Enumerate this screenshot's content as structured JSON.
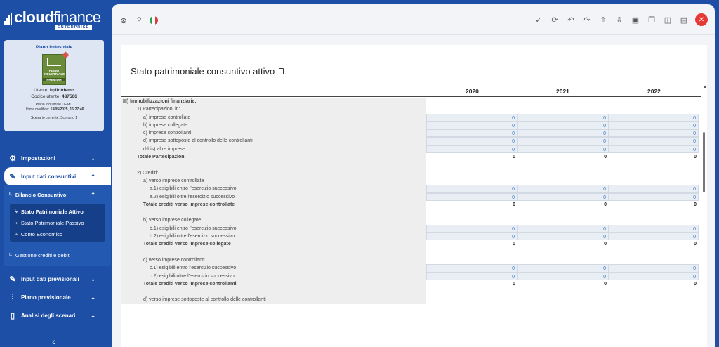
{
  "app": {
    "logo_bold": "cloud",
    "logo_light": "finance",
    "logo_sub": "ENTERPRISE"
  },
  "info": {
    "title": "Piano Industriale",
    "badge_lines": [
      "PIANO",
      "INDUSTRIALE"
    ],
    "badge_premium": "PREMIUM",
    "user_label": "Utente: ",
    "user": "bpilotdemo",
    "code_label": "Codice utente: ",
    "code": "487566",
    "plan": "Piano Industrale DEMO",
    "modified_label": "Ultima modifica: ",
    "modified": "13/05/2025, 16:27:46",
    "scenario": "Scenario corrente: Scenario 1"
  },
  "nav": {
    "impostazioni": "Impostazioni",
    "input_consuntivi": "Input dati consuntivi",
    "bilancio": "Bilancio Consuntivo",
    "sp_attivo": "Stato Patrimoniale Attivo",
    "sp_passivo": "Stato Patrimoniale Passivo",
    "conto_economico": "Conto Economico",
    "gestione_crediti": "Gestione crediti e debiti",
    "input_previsionali": "Input dati previsionali",
    "piano_previsionale": "Piano previsionale",
    "analisi_scenari": "Analisi degli scenari"
  },
  "page": {
    "title": "Stato patrimoniale consuntivo attivo",
    "years": [
      "2020",
      "2021",
      "2022"
    ]
  },
  "rows": [
    {
      "type": "bold",
      "indent": 0,
      "label": "III) Immobilizzazioni finanziarie:"
    },
    {
      "type": "text",
      "indent": 1,
      "label": "1) Partecipazioni in:"
    },
    {
      "type": "input",
      "indent": 2,
      "label": "a) imprese controllate",
      "values": [
        "0",
        "0",
        "0"
      ]
    },
    {
      "type": "input",
      "indent": 2,
      "label": "b) imprese collegate",
      "values": [
        "0",
        "0",
        "0"
      ]
    },
    {
      "type": "input",
      "indent": 2,
      "label": "c) imprese controllanti",
      "values": [
        "0",
        "0",
        "0"
      ]
    },
    {
      "type": "input",
      "indent": 2,
      "label": "d) imprese sottoposte al controllo delle controllanti",
      "values": [
        "0",
        "0",
        "0"
      ]
    },
    {
      "type": "input",
      "indent": 2,
      "label": "d-bis) altre imprese",
      "values": [
        "0",
        "0",
        "0"
      ]
    },
    {
      "type": "total",
      "indent": 1,
      "label": "Totale Partecipazioni",
      "values": [
        "0",
        "0",
        "0"
      ]
    },
    {
      "type": "blank"
    },
    {
      "type": "text",
      "indent": 1,
      "label": "2) Crediti:"
    },
    {
      "type": "text",
      "indent": 2,
      "label": "a) verso imprese controllate"
    },
    {
      "type": "input",
      "indent": 3,
      "label": "a.1) esigibili entro l'esercizio successivo",
      "values": [
        "0",
        "0",
        "0"
      ]
    },
    {
      "type": "input",
      "indent": 3,
      "label": "a.2) esigibili oltre l'esercizio successivo",
      "values": [
        "0",
        "0",
        "0"
      ]
    },
    {
      "type": "total",
      "indent": 2,
      "label": "Totale crediti verso imprese controllate",
      "values": [
        "0",
        "0",
        "0"
      ]
    },
    {
      "type": "blank"
    },
    {
      "type": "text",
      "indent": 2,
      "label": "b) verso imprese collegate"
    },
    {
      "type": "input",
      "indent": 3,
      "label": "b.1) esigibili entro l'esercizio successivo",
      "values": [
        "0",
        "0",
        "0"
      ]
    },
    {
      "type": "input",
      "indent": 3,
      "label": "b.2) esigibili oltre l'esercizio successivo",
      "values": [
        "0",
        "0",
        "0"
      ]
    },
    {
      "type": "total",
      "indent": 2,
      "label": "Totale crediti verso imprese collegate",
      "values": [
        "0",
        "0",
        "0"
      ]
    },
    {
      "type": "blank"
    },
    {
      "type": "text",
      "indent": 2,
      "label": "c) verso imprese controllanti"
    },
    {
      "type": "input",
      "indent": 3,
      "label": "c.1) esigibili entro l'esercizio successivo",
      "values": [
        "0",
        "0",
        "0"
      ]
    },
    {
      "type": "input",
      "indent": 3,
      "label": "c.2) esigibili oltre l'esercizio successivo",
      "values": [
        "0",
        "0",
        "0"
      ]
    },
    {
      "type": "total",
      "indent": 2,
      "label": "Totale crediti verso imprese controllanti",
      "values": [
        "0",
        "0",
        "0"
      ]
    },
    {
      "type": "blank"
    },
    {
      "type": "text",
      "indent": 2,
      "label": "d) verso imprese sottoposte al controllo delle controllanti"
    }
  ]
}
